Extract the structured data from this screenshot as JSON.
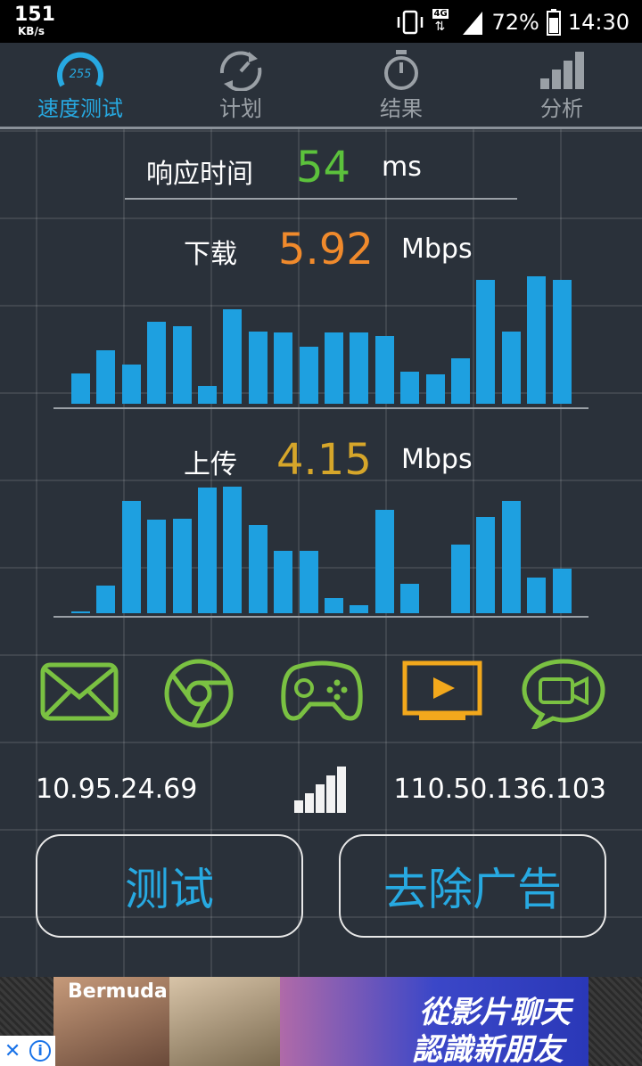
{
  "status": {
    "speed_value": "151",
    "speed_unit": "KB/s",
    "network": "4G",
    "battery": "72%",
    "time": "14:30"
  },
  "tabs": [
    {
      "label": "速度测试",
      "icon": "speedometer-icon",
      "badge": "255",
      "active": true
    },
    {
      "label": "计划",
      "icon": "refresh-gauge-icon",
      "active": false
    },
    {
      "label": "结果",
      "icon": "stopwatch-icon",
      "active": false
    },
    {
      "label": "分析",
      "icon": "signal-bars-icon",
      "active": false
    }
  ],
  "ping": {
    "label": "响应时间",
    "value": "54",
    "unit": "ms",
    "color": "#5cc23c"
  },
  "download": {
    "label": "下载",
    "value": "5.92",
    "unit": "Mbps",
    "color": "#f08a2c",
    "bars": [
      0.24,
      0.42,
      0.31,
      0.64,
      0.61,
      0.14,
      0.74,
      0.57,
      0.56,
      0.45,
      0.56,
      0.56,
      0.53,
      0.25,
      0.23,
      0.36,
      0.97,
      0.57,
      1.0,
      0.97
    ]
  },
  "upload": {
    "label": "上传",
    "value": "4.15",
    "unit": "Mbps",
    "color": "#d6a62a",
    "bars": [
      0.01,
      0.22,
      0.89,
      0.74,
      0.75,
      0.99,
      1.0,
      0.7,
      0.49,
      0.49,
      0.12,
      0.06,
      0.82,
      0.23,
      0.0,
      0.54,
      0.76,
      0.89,
      0.28,
      0.35
    ]
  },
  "services": [
    {
      "name": "mail-icon",
      "color": "#7ac142"
    },
    {
      "name": "browser-icon",
      "color": "#7ac142"
    },
    {
      "name": "gamepad-icon",
      "color": "#7ac142"
    },
    {
      "name": "video-tv-icon",
      "color": "#f2a81c"
    },
    {
      "name": "video-chat-icon",
      "color": "#7ac142"
    }
  ],
  "network": {
    "local_ip": "10.95.24.69",
    "server_ip": "110.50.136.103",
    "signal_icon": "signal-strength-icon"
  },
  "buttons": {
    "test": "测试",
    "remove_ads": "去除广告"
  },
  "ad": {
    "brand": "Bermuda",
    "line1": "從影片聊天",
    "line2": "認識新朋友"
  }
}
